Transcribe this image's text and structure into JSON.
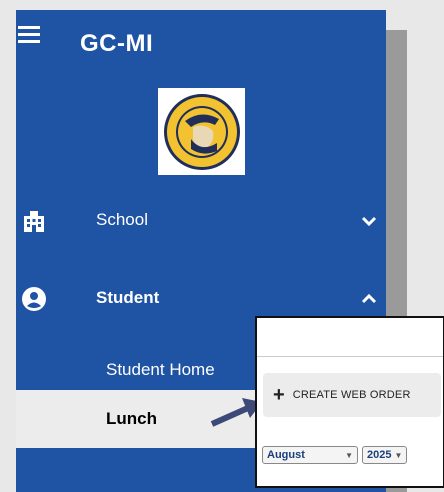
{
  "app": {
    "title": "GC-MI"
  },
  "logo": {
    "ring_text_top": "GRACE CHRISTIAN",
    "ring_text_bottom": "SCHOOL"
  },
  "nav": {
    "school": {
      "label": "School",
      "icon": "school-building-icon",
      "chevron": "chevron-down-icon"
    },
    "student": {
      "label": "Student",
      "icon": "account-circle-icon",
      "chevron": "chevron-up-icon"
    },
    "sub_items": [
      {
        "label": "Student Home"
      },
      {
        "label": "Lunch"
      }
    ]
  },
  "popup": {
    "create_button": {
      "plus": "+",
      "label": "CREATE WEB ORDER"
    },
    "month_select": {
      "value": "August"
    },
    "year_select": {
      "value": "2025"
    }
  },
  "colors": {
    "sidebar": "#1f53a3",
    "selected_row": "#ececec",
    "arrow": "#3d4a78"
  }
}
